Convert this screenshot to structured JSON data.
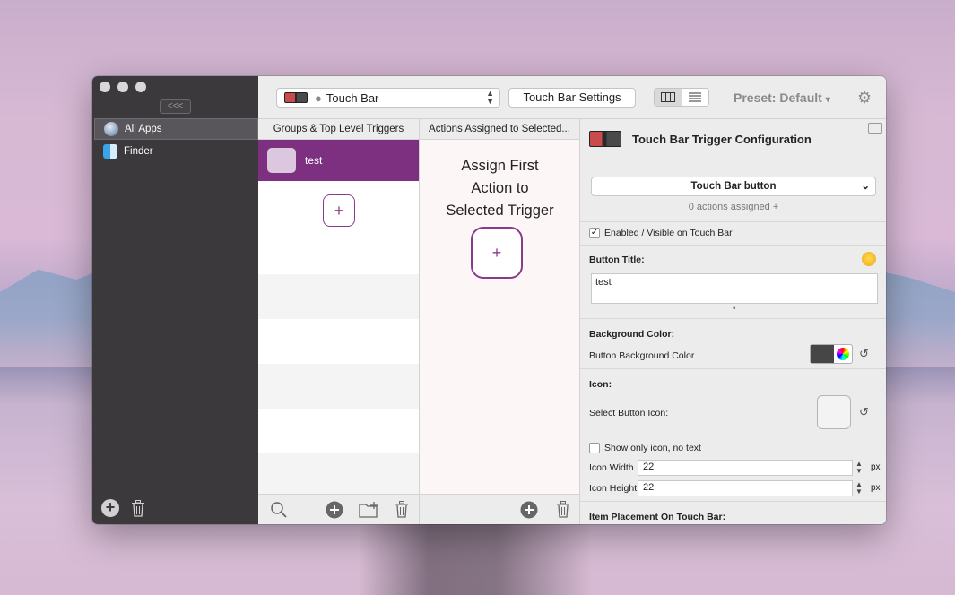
{
  "sidebar": {
    "collapse_label": "<<<",
    "items": [
      {
        "label": "All Apps",
        "icon": "globe-icon",
        "selected": true
      },
      {
        "label": "Finder",
        "icon": "finder-icon",
        "selected": false
      }
    ]
  },
  "toolbar": {
    "target_label": "Touch Bar",
    "settings_label": "Touch Bar Settings",
    "preset_label": "Preset: Default",
    "preset_arrow": "▾"
  },
  "groups": {
    "header": "Groups & Top Level Triggers",
    "trigger_label": "test",
    "add_label": "+"
  },
  "actions": {
    "header": "Actions Assigned to Selected...",
    "assign_line1": "Assign First",
    "assign_line2": "Action to",
    "assign_line3": "Selected Trigger",
    "add_label": "+"
  },
  "config": {
    "title": "Touch Bar Trigger Configuration",
    "type_value": "Touch Bar button",
    "assigned_text": "0 actions assigned +",
    "enabled_label": "Enabled / Visible on Touch Bar",
    "button_title_label": "Button Title:",
    "button_title_value": "test",
    "small_mark": "°",
    "bg_color_label": "Background Color:",
    "bg_color_sublabel": "Button Background Color",
    "bg_color": "#464646",
    "icon_label": "Icon:",
    "select_icon_label": "Select Button Icon:",
    "show_only_icon_label": "Show only icon, no text",
    "icon_width_label": "Icon Width",
    "icon_width_value": "22",
    "icon_height_label": "Icon Height",
    "icon_height_value": "22",
    "unit": "px",
    "placement_label": "Item Placement On Touch Bar:"
  },
  "colors": {
    "accent": "#7d2f80",
    "sidebar_bg": "#3b393c"
  }
}
